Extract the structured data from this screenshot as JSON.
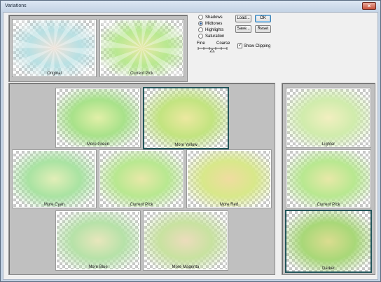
{
  "window": {
    "title": "Variations",
    "close_label": "×"
  },
  "preview": {
    "original": {
      "label": "Original",
      "c1": "#efe2d8",
      "c2": "#b8e0e3"
    },
    "current": {
      "label": "Current Pick",
      "c1": "#e8e8a8",
      "c2": "#b8e890"
    }
  },
  "options": {
    "modes": [
      {
        "label": "Shadows",
        "checked": false
      },
      {
        "label": "Midtones",
        "checked": true
      },
      {
        "label": "Highlights",
        "checked": false
      },
      {
        "label": "Saturation",
        "checked": false
      }
    ],
    "fine_label": "Fine",
    "coarse_label": "Coarse",
    "show_clipping_label": "Show Clipping",
    "show_clipping_checked": true,
    "load_label": "Load...",
    "save_label": "Save...",
    "ok_label": "OK",
    "reset_label": "Reset"
  },
  "hue_grid": {
    "more_green": {
      "label": "More Green",
      "c1": "#e2efa8",
      "c2": "#a8e28a"
    },
    "more_yellow": {
      "label": "More Yellow",
      "c1": "#ece8a0",
      "c2": "#c2e480"
    },
    "more_cyan": {
      "label": "More Cyan",
      "c1": "#e2eeb8",
      "c2": "#a9e3a2"
    },
    "current_pick": {
      "label": "Current Pick",
      "c1": "#e8e8a8",
      "c2": "#b8e890"
    },
    "more_red": {
      "label": "More Red",
      "c1": "#f0dca0",
      "c2": "#d8e88a"
    },
    "more_blue": {
      "label": "More Blue",
      "c1": "#e8e6bc",
      "c2": "#b6e2a8"
    },
    "more_magenta": {
      "label": "More Magenta",
      "c1": "#ecdcbc",
      "c2": "#c8e2a0"
    }
  },
  "brightness": {
    "lighter": {
      "label": "Lighter",
      "c1": "#f2efc0",
      "c2": "#d0ecac"
    },
    "current_pick": {
      "label": "Current Pick",
      "c1": "#e8e8a8",
      "c2": "#b8e890"
    },
    "darker": {
      "label": "Darker",
      "c1": "#dbdc90",
      "c2": "#a8d878"
    }
  }
}
